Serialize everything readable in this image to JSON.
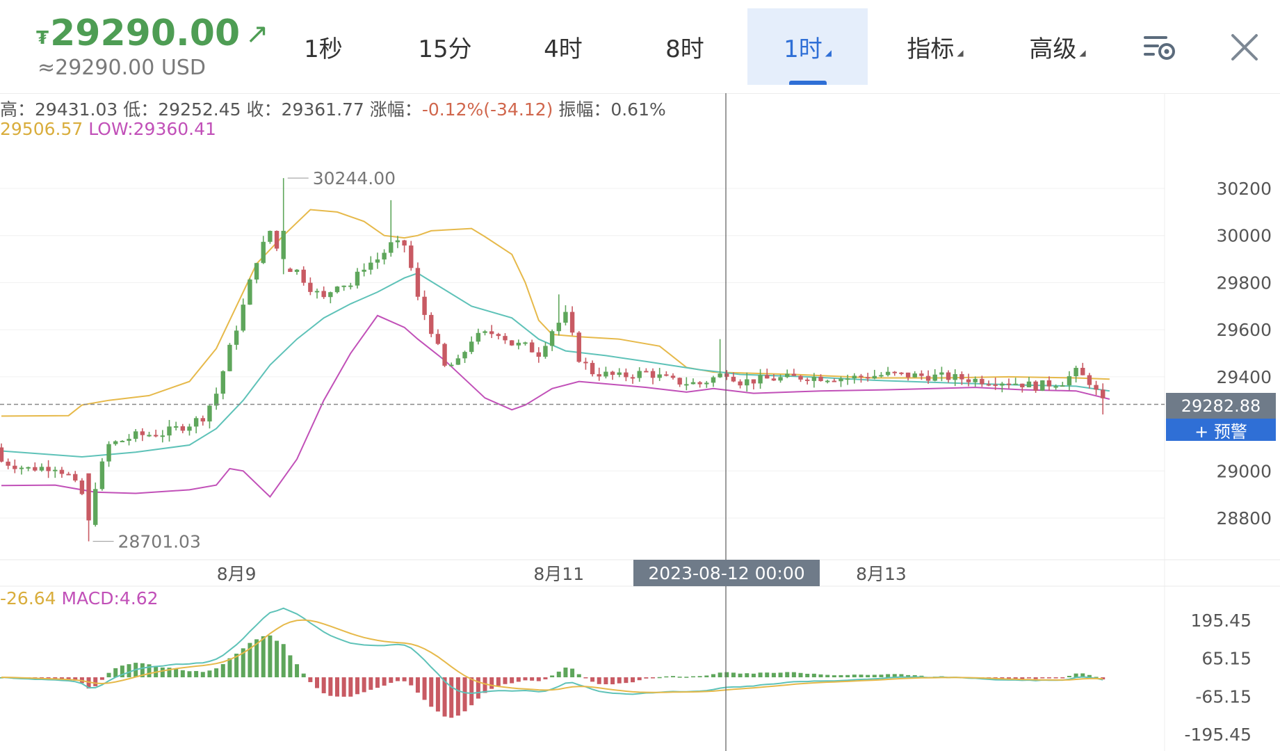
{
  "header": {
    "currency_symbol": "₮",
    "price": "29290.00",
    "usd_price": "≈29290.00 USD",
    "tabs": [
      {
        "label": "1秒",
        "active": false,
        "dropdown": false
      },
      {
        "label": "15分",
        "active": false,
        "dropdown": false
      },
      {
        "label": "4时",
        "active": false,
        "dropdown": false
      },
      {
        "label": "8时",
        "active": false,
        "dropdown": false
      },
      {
        "label": "1时",
        "active": true,
        "dropdown": true
      },
      {
        "label": "指标",
        "active": false,
        "dropdown": true
      },
      {
        "label": "高级",
        "active": false,
        "dropdown": true
      }
    ],
    "icons": [
      "settings-icon",
      "close-icon"
    ]
  },
  "info_bar": {
    "high_label": "高：",
    "high": "29431.03",
    "low_label": "低：",
    "low": "29252.45",
    "close_label": "收：",
    "close": "29361.77",
    "change_label": "涨幅：",
    "change": "-0.12%(-34.12)",
    "amp_label": "振幅：",
    "amp": "0.61%"
  },
  "boll_label": {
    "up_value": "29506.57",
    "low_text": "LOW:29360.41"
  },
  "macd_label": {
    "dea_value": "-26.64",
    "macd_text": "MACD:4.62"
  },
  "colors": {
    "up": "#5ea65b",
    "down": "#c85a63",
    "upper_band": "#e6b94a",
    "middle_band": "#5ec2b8",
    "lower_band": "#c150b8",
    "dif": "#5ec2b8",
    "dea": "#e6b94a",
    "accent": "#2f6fd6",
    "crosshair_label_bg": "#6f7b89"
  },
  "current_price_tag": "29282.88",
  "alert_button": "+ 预警",
  "crosshair_label": "2023-08-12 00:00",
  "chart_data": [
    {
      "type": "candlestick",
      "title": "",
      "y_ticks": [
        28800,
        29000,
        29400,
        29600,
        29800,
        30000,
        30200
      ],
      "ylim": [
        28650,
        30300
      ],
      "x_tick_labels": [
        {
          "label": "8月9",
          "index": 35
        },
        {
          "label": "8月11",
          "index": 83
        },
        {
          "label": "8月13",
          "index": 131
        }
      ],
      "high_marker": "30244.00",
      "low_marker": "28701.03",
      "current_price": 29282.88,
      "crosshair_index": 108,
      "bollinger": {
        "upper": [
          [
            0,
            29233
          ],
          [
            10,
            29235
          ],
          [
            12,
            29280
          ],
          [
            16,
            29300
          ],
          [
            22,
            29320
          ],
          [
            28,
            29380
          ],
          [
            32,
            29520
          ],
          [
            38,
            29880
          ],
          [
            42,
            30000
          ],
          [
            46,
            30110
          ],
          [
            50,
            30100
          ],
          [
            54,
            30060
          ],
          [
            57,
            30000
          ],
          [
            60,
            29990
          ],
          [
            62,
            30000
          ],
          [
            64,
            30020
          ],
          [
            70,
            30030
          ],
          [
            72,
            29995
          ],
          [
            76,
            29920
          ],
          [
            78,
            29800
          ],
          [
            80,
            29640
          ],
          [
            82,
            29580
          ],
          [
            86,
            29570
          ],
          [
            92,
            29560
          ],
          [
            98,
            29530
          ],
          [
            102,
            29440
          ],
          [
            106,
            29420
          ],
          [
            118,
            29410
          ],
          [
            130,
            29395
          ],
          [
            140,
            29395
          ],
          [
            150,
            29400
          ],
          [
            160,
            29395
          ],
          [
            165,
            29390
          ]
        ],
        "middle": [
          [
            0,
            29085
          ],
          [
            12,
            29060
          ],
          [
            20,
            29080
          ],
          [
            28,
            29110
          ],
          [
            32,
            29180
          ],
          [
            36,
            29300
          ],
          [
            40,
            29450
          ],
          [
            44,
            29560
          ],
          [
            48,
            29650
          ],
          [
            52,
            29710
          ],
          [
            56,
            29760
          ],
          [
            60,
            29820
          ],
          [
            62,
            29840
          ],
          [
            66,
            29770
          ],
          [
            70,
            29700
          ],
          [
            76,
            29650
          ],
          [
            80,
            29560
          ],
          [
            84,
            29510
          ],
          [
            90,
            29490
          ],
          [
            96,
            29465
          ],
          [
            104,
            29430
          ],
          [
            110,
            29410
          ],
          [
            120,
            29400
          ],
          [
            130,
            29385
          ],
          [
            140,
            29375
          ],
          [
            152,
            29365
          ],
          [
            160,
            29360
          ],
          [
            165,
            29340
          ]
        ],
        "lower": [
          [
            0,
            28938
          ],
          [
            8,
            28940
          ],
          [
            14,
            28910
          ],
          [
            20,
            28905
          ],
          [
            28,
            28920
          ],
          [
            32,
            28940
          ],
          [
            34,
            29010
          ],
          [
            36,
            29000
          ],
          [
            40,
            28890
          ],
          [
            44,
            29050
          ],
          [
            48,
            29300
          ],
          [
            52,
            29500
          ],
          [
            56,
            29660
          ],
          [
            60,
            29610
          ],
          [
            62,
            29560
          ],
          [
            66,
            29470
          ],
          [
            72,
            29310
          ],
          [
            76,
            29260
          ],
          [
            78,
            29280
          ],
          [
            82,
            29350
          ],
          [
            86,
            29380
          ],
          [
            96,
            29355
          ],
          [
            102,
            29335
          ],
          [
            106,
            29350
          ],
          [
            112,
            29330
          ],
          [
            122,
            29340
          ],
          [
            132,
            29345
          ],
          [
            145,
            29355
          ],
          [
            152,
            29345
          ],
          [
            160,
            29340
          ],
          [
            165,
            29305
          ]
        ]
      }
    },
    {
      "type": "macd",
      "y_ticks": [
        195.45,
        65.15,
        -65.15,
        -195.45
      ],
      "ylim": [
        -215,
        240
      ]
    }
  ]
}
